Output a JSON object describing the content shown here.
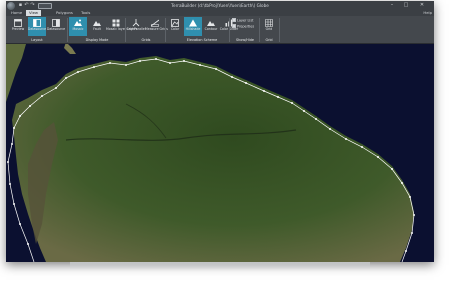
{
  "window": {
    "title": "TerraBuilder (d:\\tbProj\\Yuen\\Yuen\\Earth\\) Globe",
    "controls": {
      "minimize": "–",
      "maximize": "□",
      "close": "✕"
    }
  },
  "quick_access": [
    "save-icon",
    "undo-icon",
    "redo-icon"
  ],
  "menu": {
    "tabs": [
      "Home",
      "View",
      "Polygons",
      "Tools"
    ],
    "active": "View",
    "help": "Help"
  },
  "ribbon": {
    "groups": [
      {
        "label": "Layout"
      },
      {
        "label": "Display Mode"
      },
      {
        "label": "Grids"
      },
      {
        "label": "Elevation Scheme"
      },
      {
        "label": "Show/Hide"
      },
      {
        "label": "Grid"
      }
    ],
    "buttons": {
      "preview": "Preview",
      "datasource": "Datasource",
      "datasource2": "Datasource",
      "mosaic": "Mosaic",
      "fault": "Fault",
      "mosaic_layer": "Mosaic layer Layers",
      "grid_parallel": "Grid Parallel",
      "measure_grids": "Measure Grids",
      "color": "Color",
      "hillshade": "Hillshade",
      "contour": "Contour",
      "color_slider": "Color Slider",
      "grid": "Grid"
    },
    "checks": [
      "Layer List",
      "Properties"
    ],
    "accent": "#2f8fae"
  },
  "map": {
    "ocean_color": "#0b1030",
    "land_color": "#3f5a2a",
    "polygon_color": "#ffffff"
  }
}
